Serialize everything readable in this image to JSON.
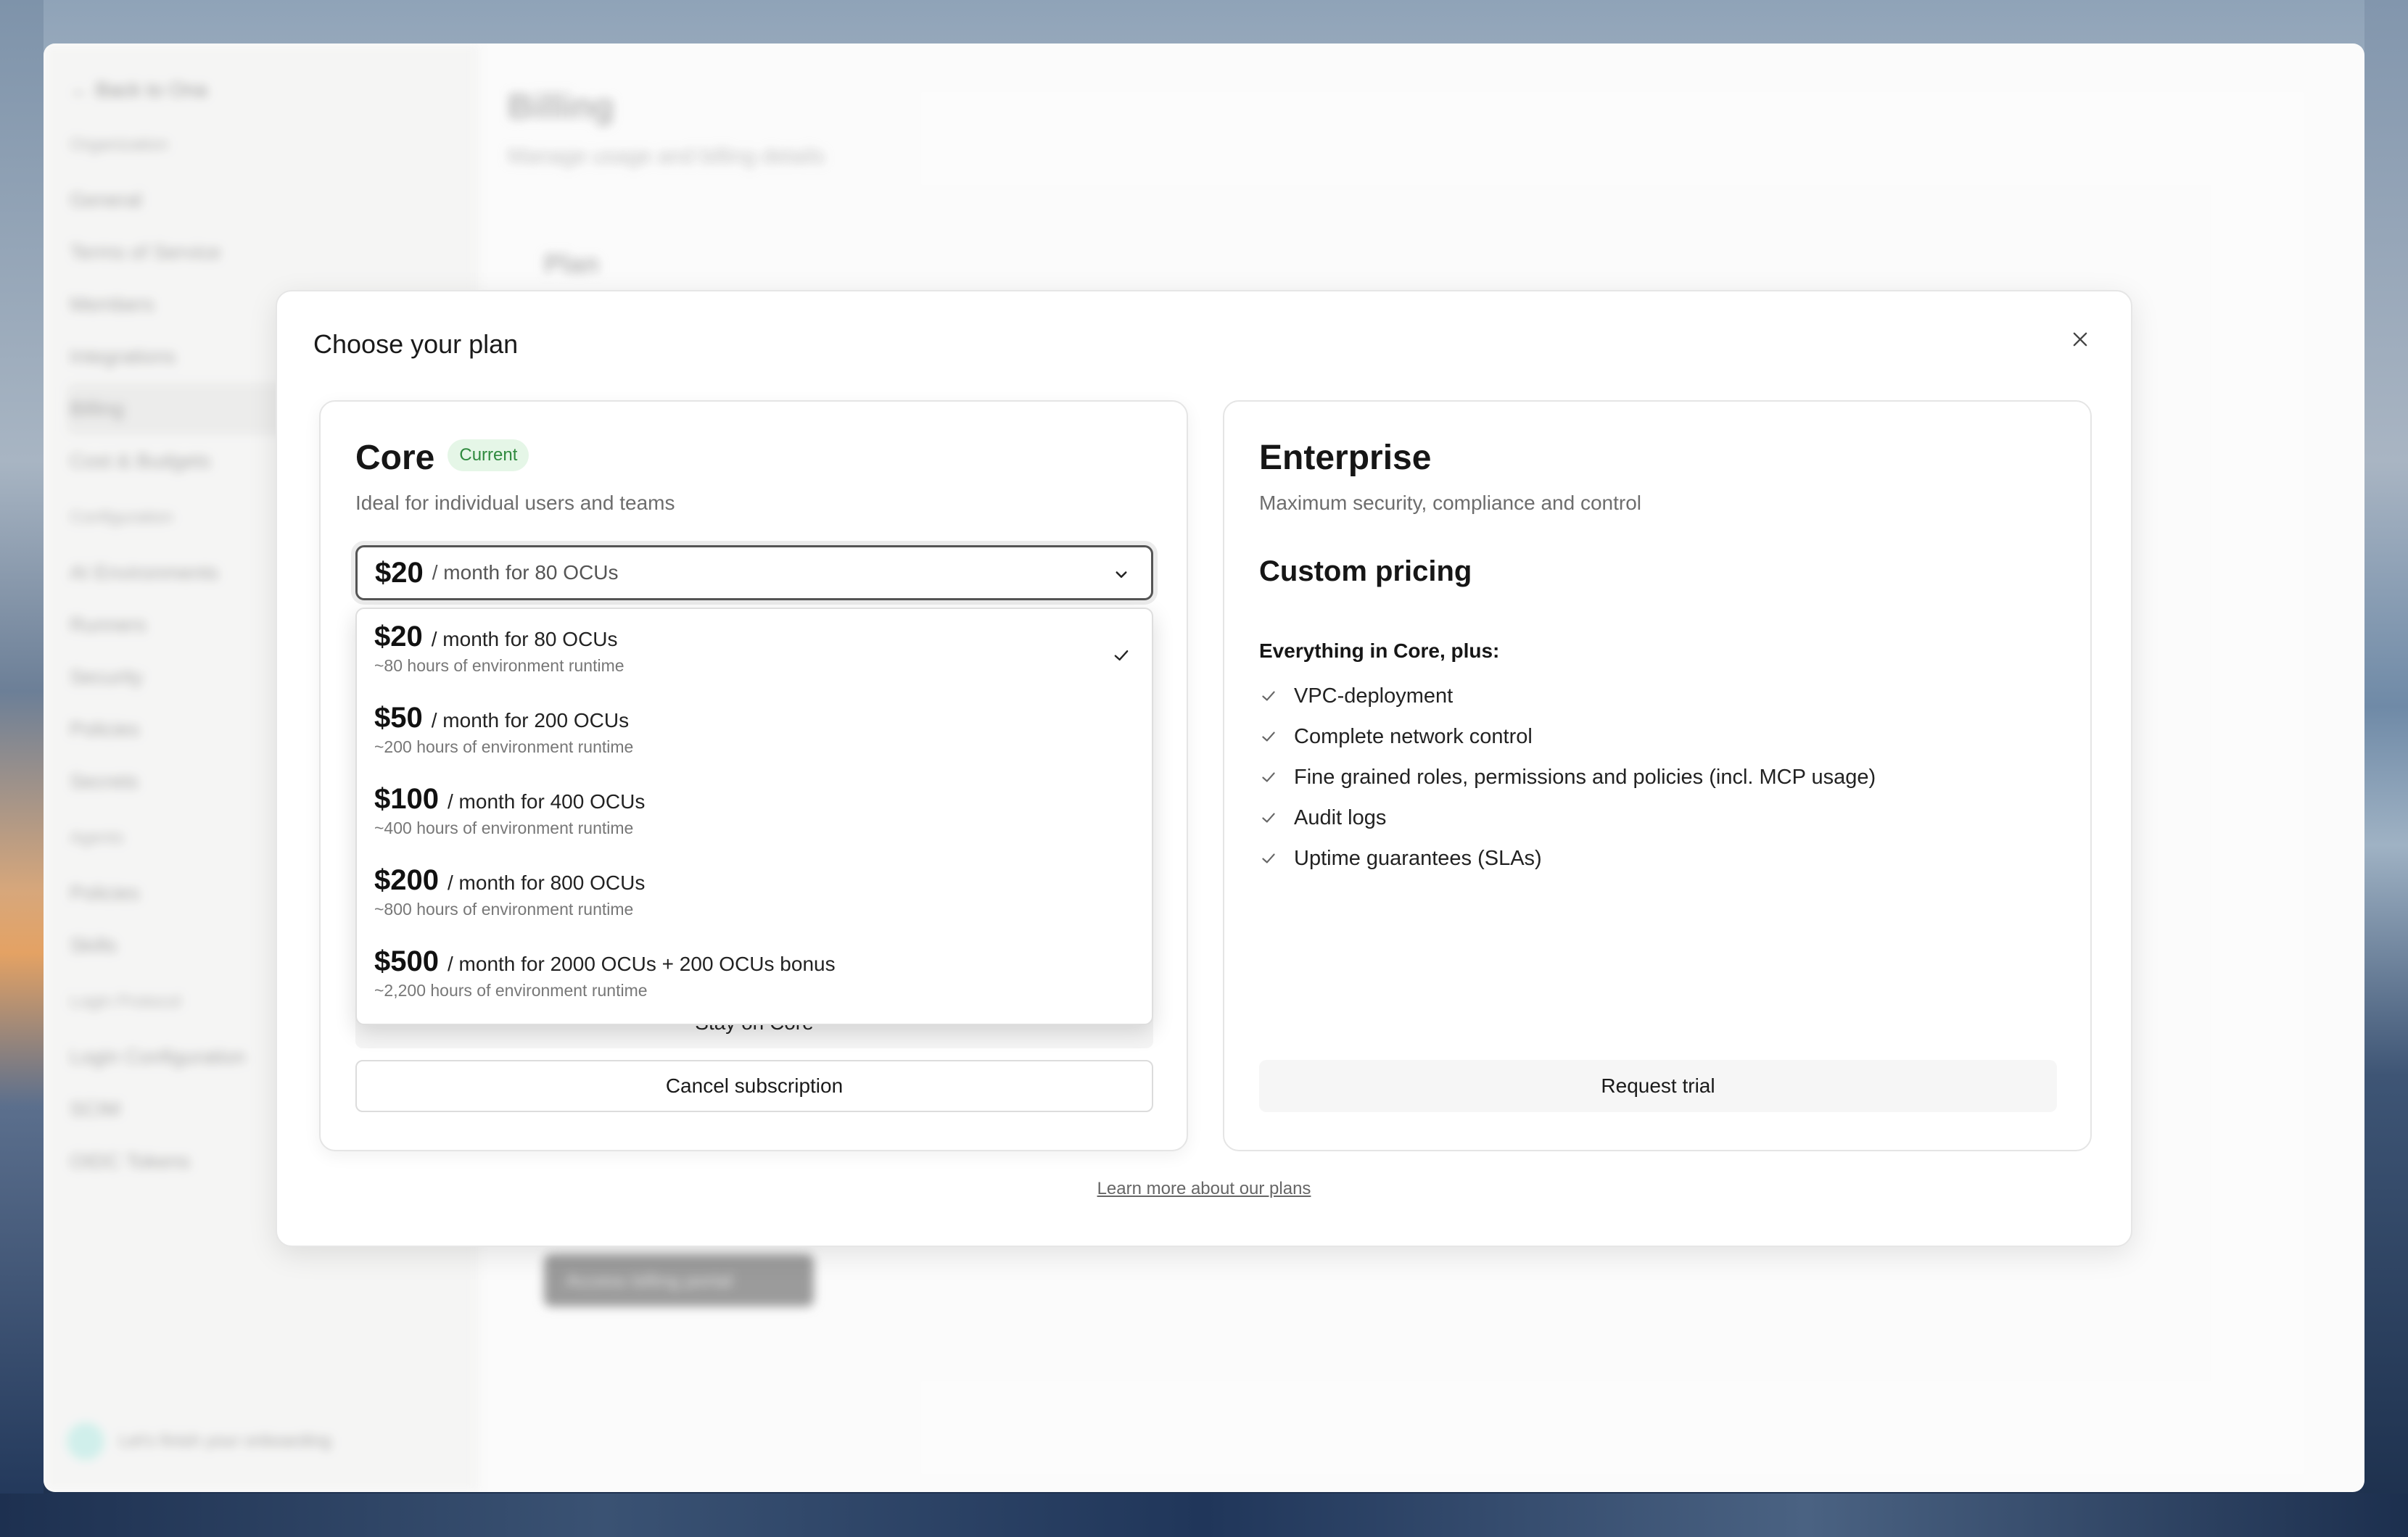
{
  "backdrop": {
    "sidebar": {
      "back": "← Back to Ona",
      "sections": [
        {
          "title": "Organization",
          "items": [
            "General",
            "Terms of Service",
            "Members",
            "Integrations",
            "Billing",
            "Cost & Budgets"
          ]
        },
        {
          "title": "Configuration",
          "items": [
            "AI Environments",
            "Runners",
            "Security",
            "Policies",
            "Secrets"
          ]
        },
        {
          "title": "Agents",
          "items": [
            "Policies",
            "Skills"
          ]
        },
        {
          "title": "Login Protocol",
          "items": [
            "Login Configuration",
            "SCIM",
            "OIDC Tokens"
          ]
        }
      ],
      "active_item": "Billing",
      "footer": "Let's finish your onboarding"
    },
    "main": {
      "title": "Billing",
      "subtitle": "Manage usage and billing details",
      "plan_label": "Plan",
      "portal_button": "Access billing portal"
    }
  },
  "modal": {
    "title": "Choose your plan",
    "core": {
      "name": "Core",
      "badge": "Current",
      "description": "Ideal for individual users and teams",
      "selected": {
        "price": "$20",
        "detail": "/ month for 80 OCUs"
      },
      "options": [
        {
          "price": "$20",
          "detail": "/ month for 80 OCUs",
          "sub": "~80 hours of environment runtime",
          "selected": true
        },
        {
          "price": "$50",
          "detail": "/ month for 200 OCUs",
          "sub": "~200 hours of environment runtime",
          "selected": false
        },
        {
          "price": "$100",
          "detail": "/ month for 400 OCUs",
          "sub": "~400 hours of environment runtime",
          "selected": false
        },
        {
          "price": "$200",
          "detail": "/ month for 800 OCUs",
          "sub": "~800 hours of environment runtime",
          "selected": false
        },
        {
          "price": "$500",
          "detail": "/ month for 2000 OCUs + 200 OCUs bonus",
          "sub": "~2,200 hours of environment runtime",
          "selected": false
        }
      ],
      "stay_button": "Stay on Core",
      "cancel_button": "Cancel subscription"
    },
    "enterprise": {
      "name": "Enterprise",
      "description": "Maximum security, compliance and control",
      "pricing": "Custom pricing",
      "features_heading": "Everything in Core, plus:",
      "features": [
        "VPC-deployment",
        "Complete network control",
        "Fine grained roles, permissions and policies (incl. MCP usage)",
        "Audit logs",
        "Uptime guarantees (SLAs)"
      ],
      "trial_button": "Request trial"
    },
    "learn_more": "Learn more about our plans"
  },
  "colors": {
    "badge_bg": "#e5f6e7",
    "badge_text": "#2f8a3e",
    "select_border": "#555555"
  }
}
